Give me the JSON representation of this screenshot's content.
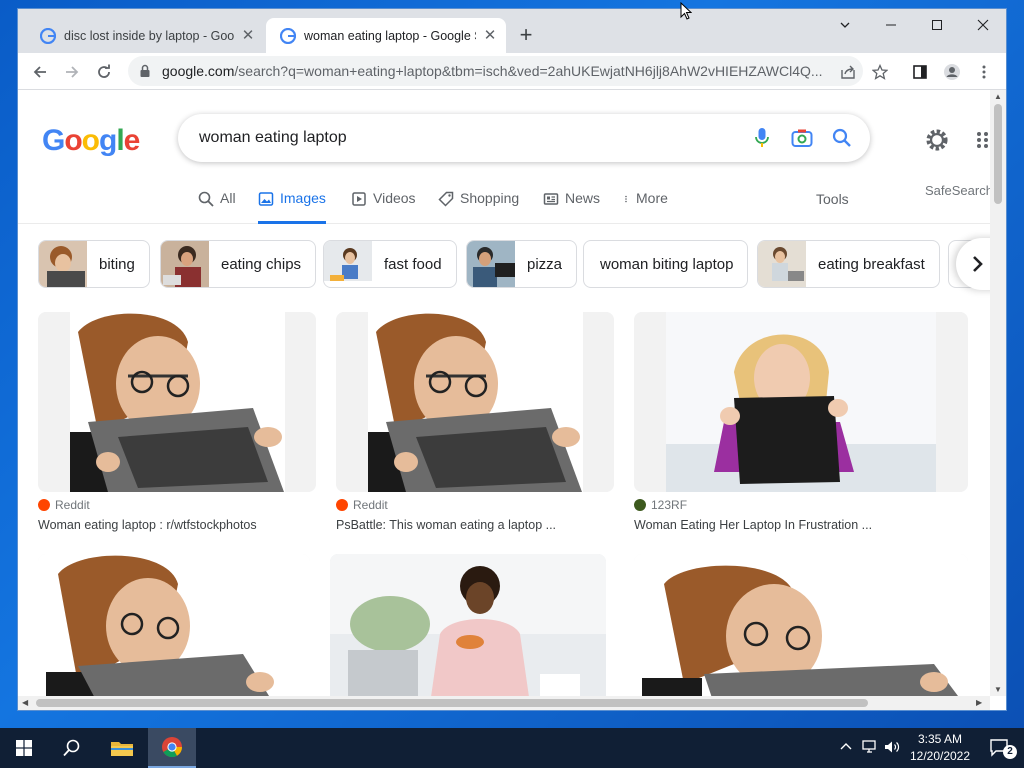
{
  "browser": {
    "tabs": [
      {
        "title": "disc lost inside by laptop - Goog",
        "active": false
      },
      {
        "title": "woman eating laptop - Google S",
        "active": true
      }
    ],
    "address": {
      "host": "google.com",
      "rest": "/search?q=woman+eating+laptop&tbm=isch&ved=2ahUKEwjatNH6jlj8AhW2vHIEHZAWCl4Q..."
    }
  },
  "google": {
    "logo_letters": [
      "G",
      "o",
      "o",
      "g",
      "l",
      "e"
    ],
    "query": "woman eating laptop",
    "nav": [
      "All",
      "Images",
      "Videos",
      "Shopping",
      "News",
      "More"
    ],
    "active_nav": "Images",
    "tools": "Tools",
    "safesearch": "SafeSearch",
    "chips": [
      "biting",
      "eating chips",
      "fast food",
      "pizza",
      "woman biting laptop",
      "eating breakfast"
    ],
    "results": [
      {
        "source": "Reddit",
        "caption": "Woman eating laptop : r/wtfstockphotos"
      },
      {
        "source": "Reddit",
        "caption": "PsBattle: This woman eating a laptop ..."
      },
      {
        "source": "123RF",
        "caption": "Woman Eating Her Laptop In Frustration ..."
      }
    ]
  },
  "taskbar": {
    "time": "3:35 AM",
    "date": "12/20/2022",
    "notifications": "2"
  },
  "colors": {
    "accent": "#1a73e8",
    "reddit": "#ff4500",
    "taskbar": "#101f35"
  }
}
